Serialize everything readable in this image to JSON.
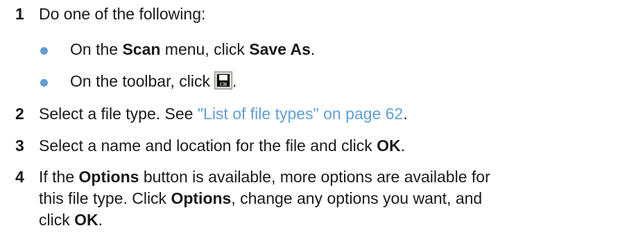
{
  "steps": [
    {
      "number": "1",
      "text": "Do one of the following:"
    },
    {
      "number": "2",
      "text_before": "Select a file type. See ",
      "link": "\"List of file types\" on page 62",
      "text_after": "."
    },
    {
      "number": "3",
      "text_before": "Select a name and location for the file and click ",
      "bold": "OK",
      "text_after": "."
    },
    {
      "number": "4",
      "line1_a": "If the ",
      "line1_b": "Options",
      "line1_c": " button is available, more options are available for",
      "line2_a": "this file type. Click ",
      "line2_b": "Options",
      "line2_c": ", change any options you want, and",
      "line3_a": "click ",
      "line3_b": "OK",
      "line3_c": "."
    }
  ],
  "bullets": [
    {
      "a": "On the ",
      "b": "Scan",
      "c": " menu, click ",
      "d": "Save As",
      "e": "."
    },
    {
      "a": "On the toolbar, click",
      "icon": "save-floppy-icon",
      "e": "."
    }
  ],
  "colors": {
    "bullet": "#5f9fd7",
    "link": "#5f9fd7",
    "text": "#1a1a1a"
  }
}
